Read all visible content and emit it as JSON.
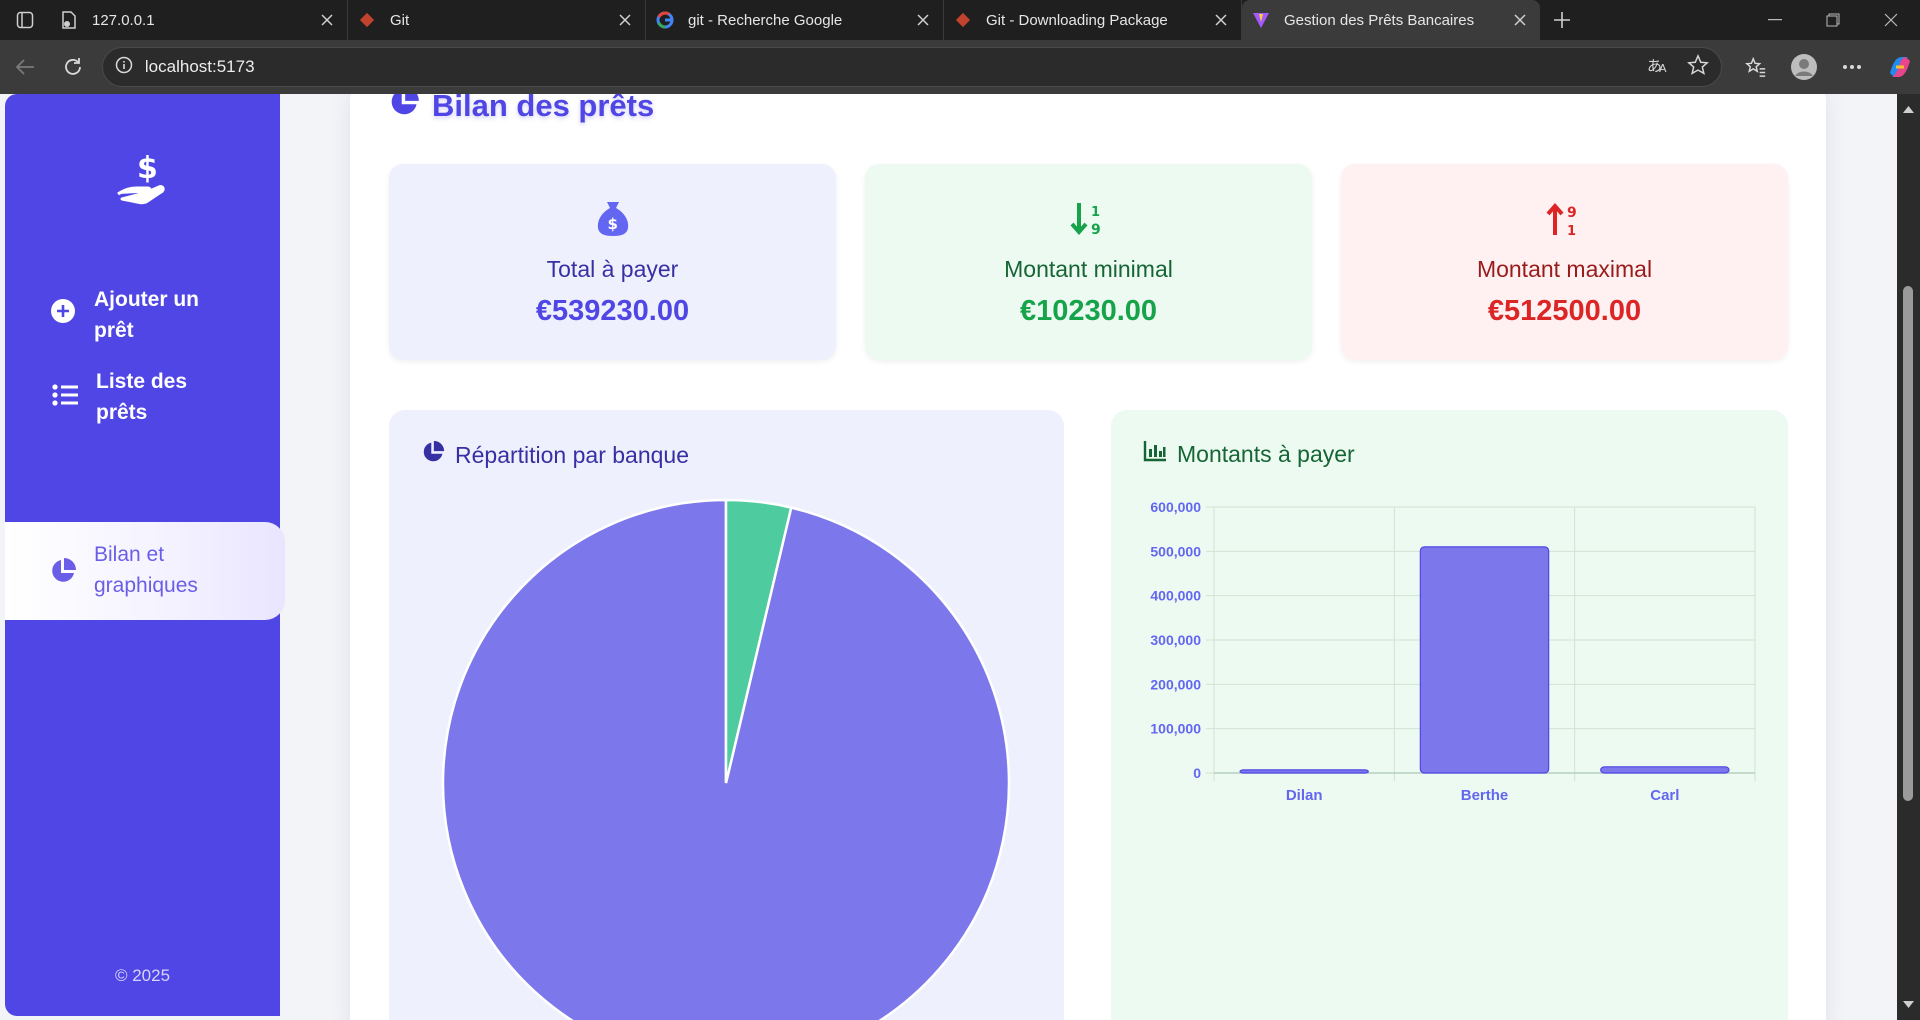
{
  "browser": {
    "tabs": [
      {
        "title": "127.0.0.1",
        "icon": "page-icon"
      },
      {
        "title": "Git",
        "icon": "git-icon"
      },
      {
        "title": "git - Recherche Google",
        "icon": "google-icon"
      },
      {
        "title": "Git - Downloading Package",
        "icon": "git-icon"
      },
      {
        "title": "Gestion des Prêts Bancaires",
        "icon": "vite-icon",
        "active": true
      }
    ],
    "url": "localhost:5173"
  },
  "sidebar": {
    "items": [
      {
        "label": "Ajouter un prêt",
        "icon": "plus-circle-icon"
      },
      {
        "label": "Liste des prêts",
        "icon": "list-icon"
      },
      {
        "label": "Bilan et graphiques",
        "icon": "pie-chart-icon",
        "active": true
      }
    ],
    "copyright": "© 2025"
  },
  "page": {
    "title": "Bilan des prêts"
  },
  "stats": [
    {
      "label": "Total à payer",
      "value": "€539230.00",
      "icon": "money-bag-icon",
      "color": "#4f46e5"
    },
    {
      "label": "Montant minimal",
      "value": "€10230.00",
      "icon": "sort-asc-icon",
      "color": "#16a34a"
    },
    {
      "label": "Montant maximal",
      "value": "€512500.00",
      "icon": "sort-desc-icon",
      "color": "#dc2626"
    }
  ],
  "pie_panel": {
    "title": "Répartition par banque"
  },
  "bar_panel": {
    "title": "Montants à payer"
  },
  "chart_data": [
    {
      "type": "pie",
      "title": "Répartition par banque",
      "slices": [
        {
          "value": 0.963,
          "color": "#7c78ec"
        },
        {
          "value": 0.037,
          "color": "#4fcc9f"
        }
      ]
    },
    {
      "type": "bar",
      "title": "Montants à payer",
      "categories": [
        "Dilan",
        "Berthe",
        "Carl"
      ],
      "values": [
        7000,
        510000,
        14000
      ],
      "ylim": [
        0,
        600000
      ],
      "yticks": [
        "600,000",
        "500,000",
        "400,000",
        "300,000",
        "200,000",
        "100,000",
        "0"
      ],
      "grid": true,
      "color": "#7c78ec"
    }
  ]
}
